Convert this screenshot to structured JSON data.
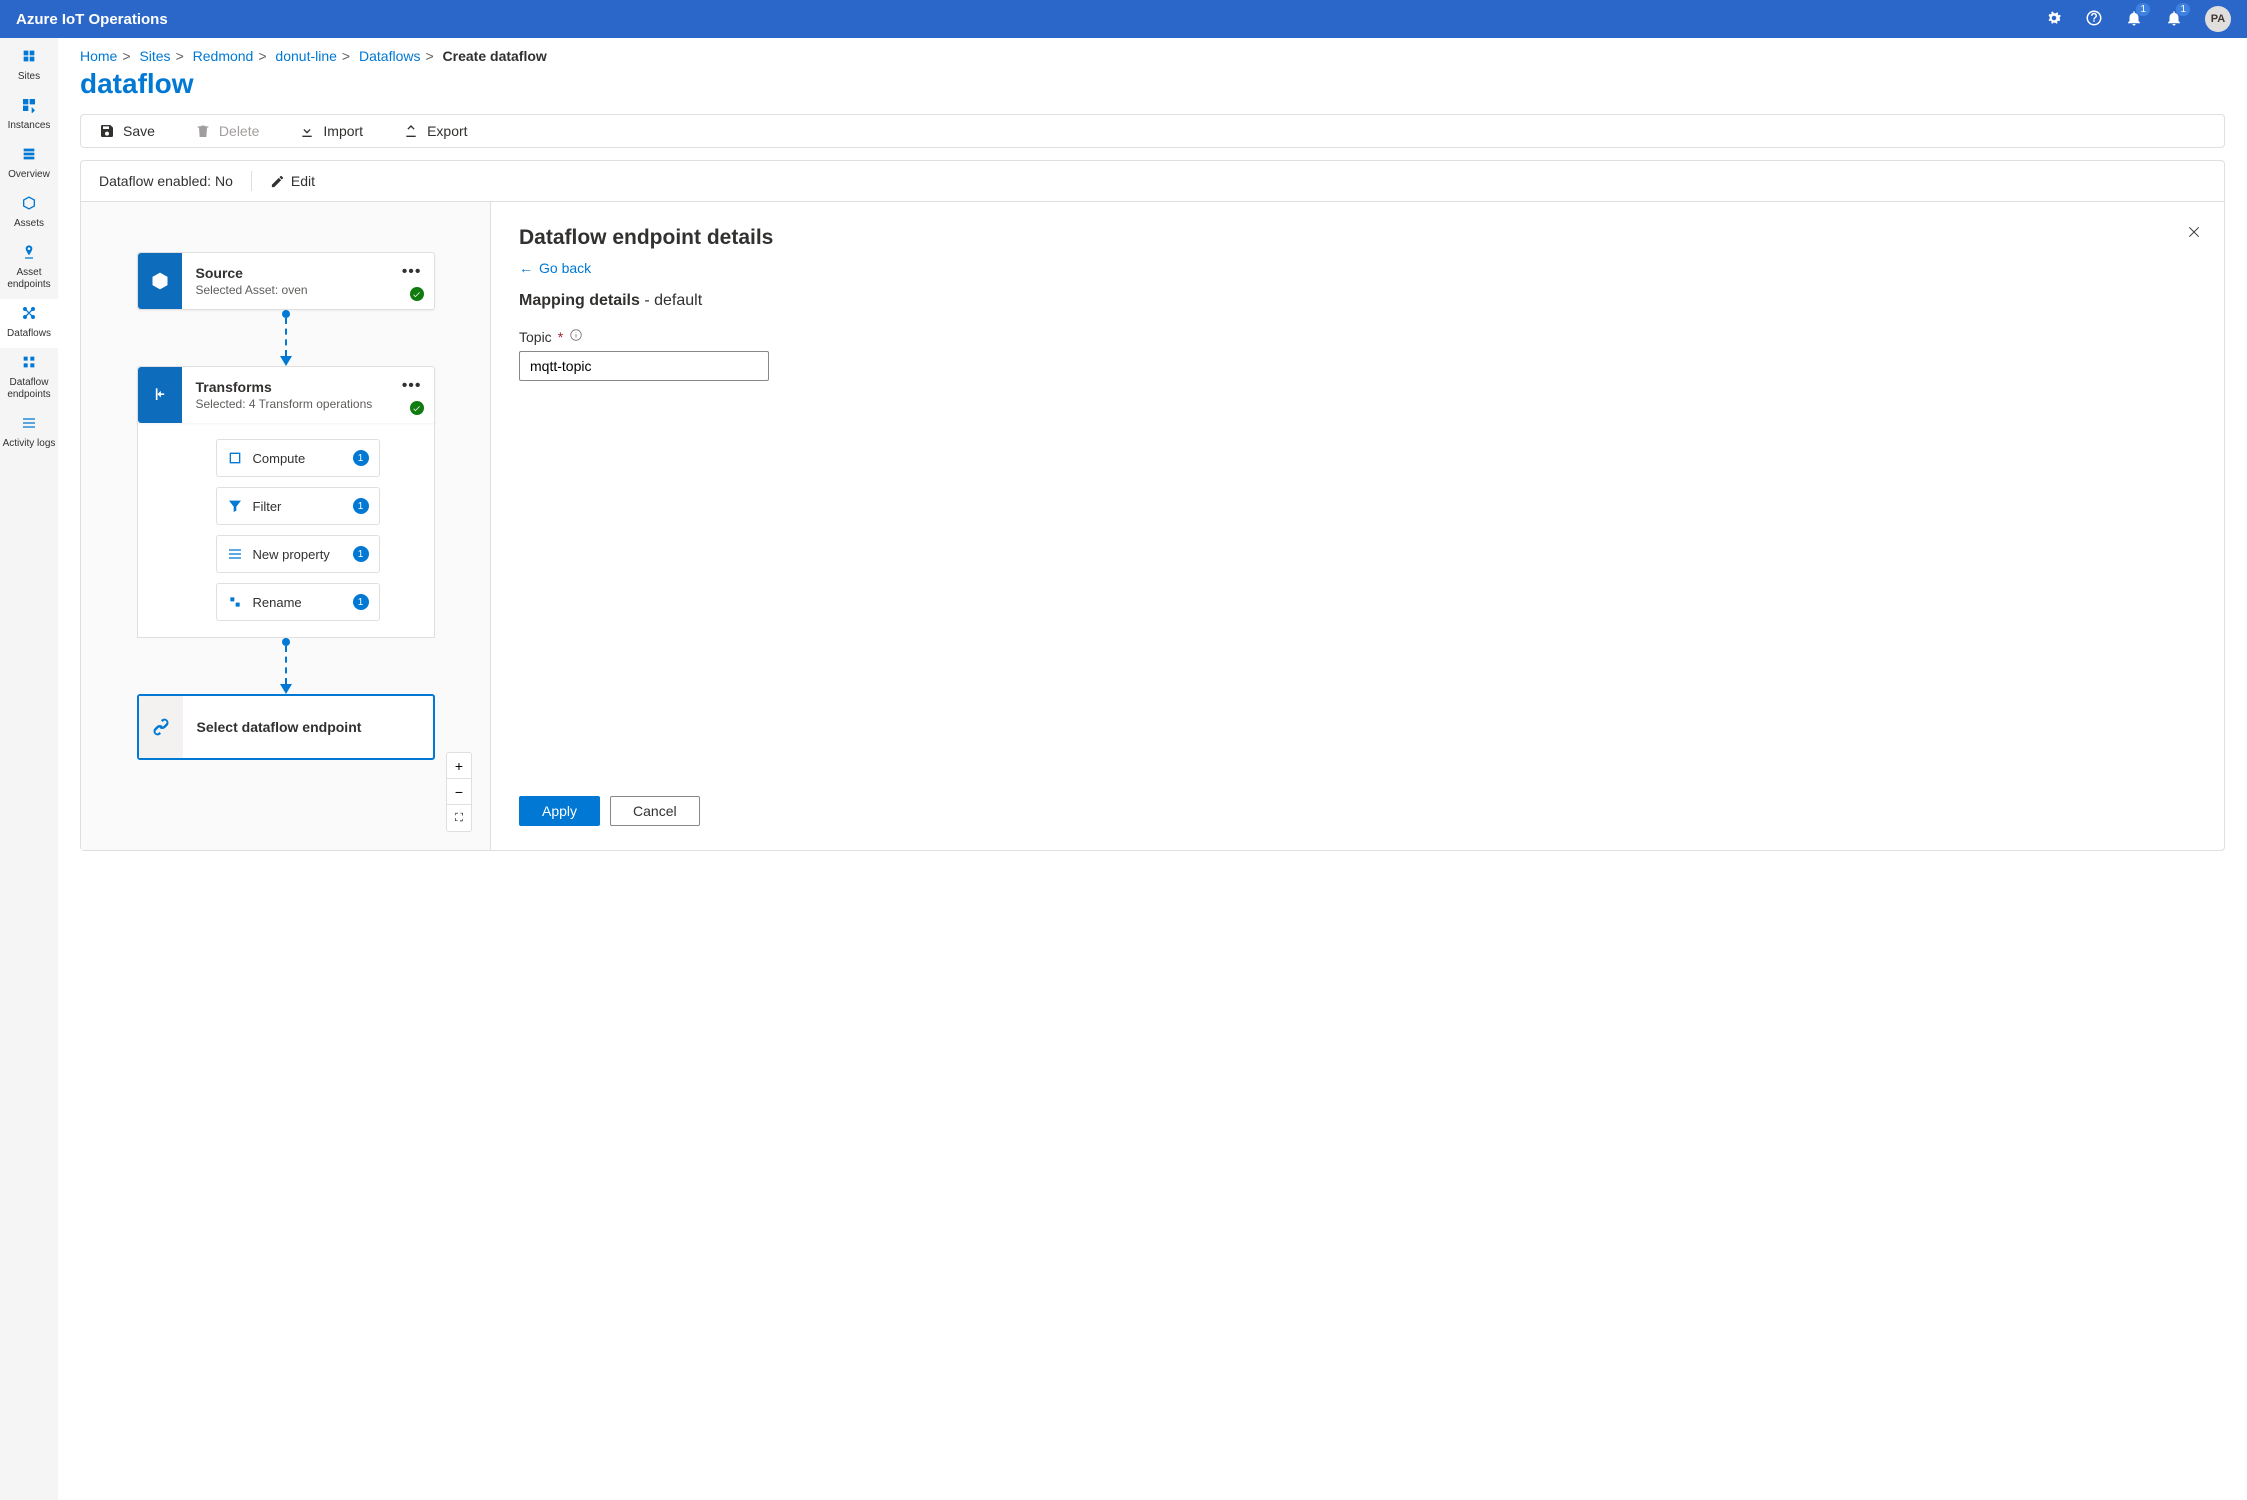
{
  "app": {
    "title": "Azure IoT Operations",
    "avatar": "PA"
  },
  "notifications": {
    "count1": "1",
    "count2": "1"
  },
  "sidebar": {
    "items": [
      {
        "label": "Sites"
      },
      {
        "label": "Instances"
      },
      {
        "label": "Overview"
      },
      {
        "label": "Assets"
      },
      {
        "label": "Asset endpoints"
      },
      {
        "label": "Dataflows"
      },
      {
        "label": "Dataflow endpoints"
      },
      {
        "label": "Activity logs"
      }
    ]
  },
  "breadcrumb": {
    "home": "Home",
    "items": [
      "Sites",
      "Redmond",
      "donut-line",
      "Dataflows"
    ],
    "current": "Create dataflow"
  },
  "page": {
    "title": "dataflow"
  },
  "commands": {
    "save": "Save",
    "delete": "Delete",
    "import": "Import",
    "export": "Export"
  },
  "status": {
    "label": "Dataflow enabled: ",
    "value": "No",
    "edit": "Edit"
  },
  "canvas": {
    "source": {
      "title": "Source",
      "sub": "Selected Asset: oven"
    },
    "transforms": {
      "title": "Transforms",
      "sub": "Selected: 4 Transform operations"
    },
    "ops": [
      {
        "label": "Compute",
        "count": "1"
      },
      {
        "label": "Filter",
        "count": "1"
      },
      {
        "label": "New property",
        "count": "1"
      },
      {
        "label": "Rename",
        "count": "1"
      }
    ],
    "select": "Select dataflow endpoint",
    "zoom": {
      "in": "+",
      "out": "−",
      "fit": "⛶"
    }
  },
  "detail": {
    "heading": "Dataflow endpoint details",
    "goback": "Go back",
    "mapping_strong": "Mapping details",
    "mapping_sep": " - ",
    "mapping_val": "default",
    "topic_label": "Topic",
    "topic_value": "mqtt-topic",
    "apply": "Apply",
    "cancel": "Cancel"
  }
}
